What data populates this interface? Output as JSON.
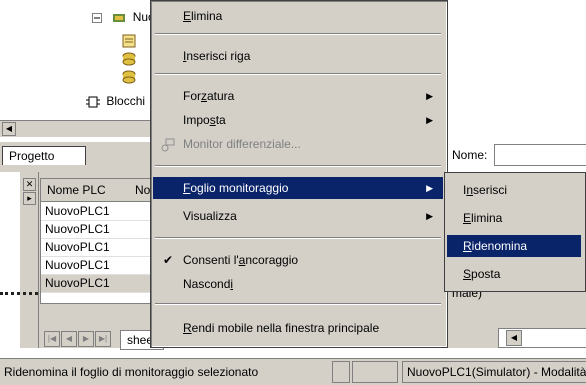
{
  "tree": {
    "nodes": [
      {
        "label": "Nuo"
      },
      {
        "label": "Blocchi"
      }
    ]
  },
  "tabs": {
    "project": "Progetto",
    "sheet": "shee"
  },
  "name_field": {
    "label": "Nome:"
  },
  "watch_table": {
    "headers": [
      "Nome PLC",
      "Nor"
    ],
    "rows": [
      "NuovoPLC1",
      "NuovoPLC1",
      "NuovoPLC1",
      "NuovoPLC1",
      "NuovoPLC1"
    ],
    "partial_value": "male)"
  },
  "context_menu": {
    "items": [
      {
        "label": "Elimina",
        "accel": "E"
      },
      {
        "label": "Inserisci riga",
        "accel": "I"
      },
      {
        "label": "Forzatura",
        "accel": "z",
        "submenu": true
      },
      {
        "label": "Imposta",
        "accel": "s",
        "submenu": true
      },
      {
        "label": "Monitor differenziale...",
        "disabled": true
      },
      {
        "label": "Foglio monitoraggio",
        "accel": "F",
        "submenu": true,
        "highlighted": true
      },
      {
        "label": "Visualizza",
        "submenu": true
      },
      {
        "label": "Consenti l'ancoraggio",
        "checked": true,
        "accel": "a"
      },
      {
        "label": "Nascondi",
        "accel": "i"
      },
      {
        "label": "Rendi mobile nella finestra principale",
        "accel": "R"
      }
    ]
  },
  "submenu": {
    "items": [
      {
        "label": "Inserisci",
        "accel": "n"
      },
      {
        "label": "Elimina",
        "accel": "E"
      },
      {
        "label": "Ridenomina",
        "accel": "R",
        "highlighted": true
      },
      {
        "label": "Sposta",
        "accel": "S"
      }
    ]
  },
  "status": {
    "left": "Ridenomina il foglio di monitoraggio selezionato",
    "right": "NuovoPLC1(Simulator) - Modalità"
  },
  "colors": {
    "highlight": "#0a246a",
    "face": "#d4d0c8"
  }
}
